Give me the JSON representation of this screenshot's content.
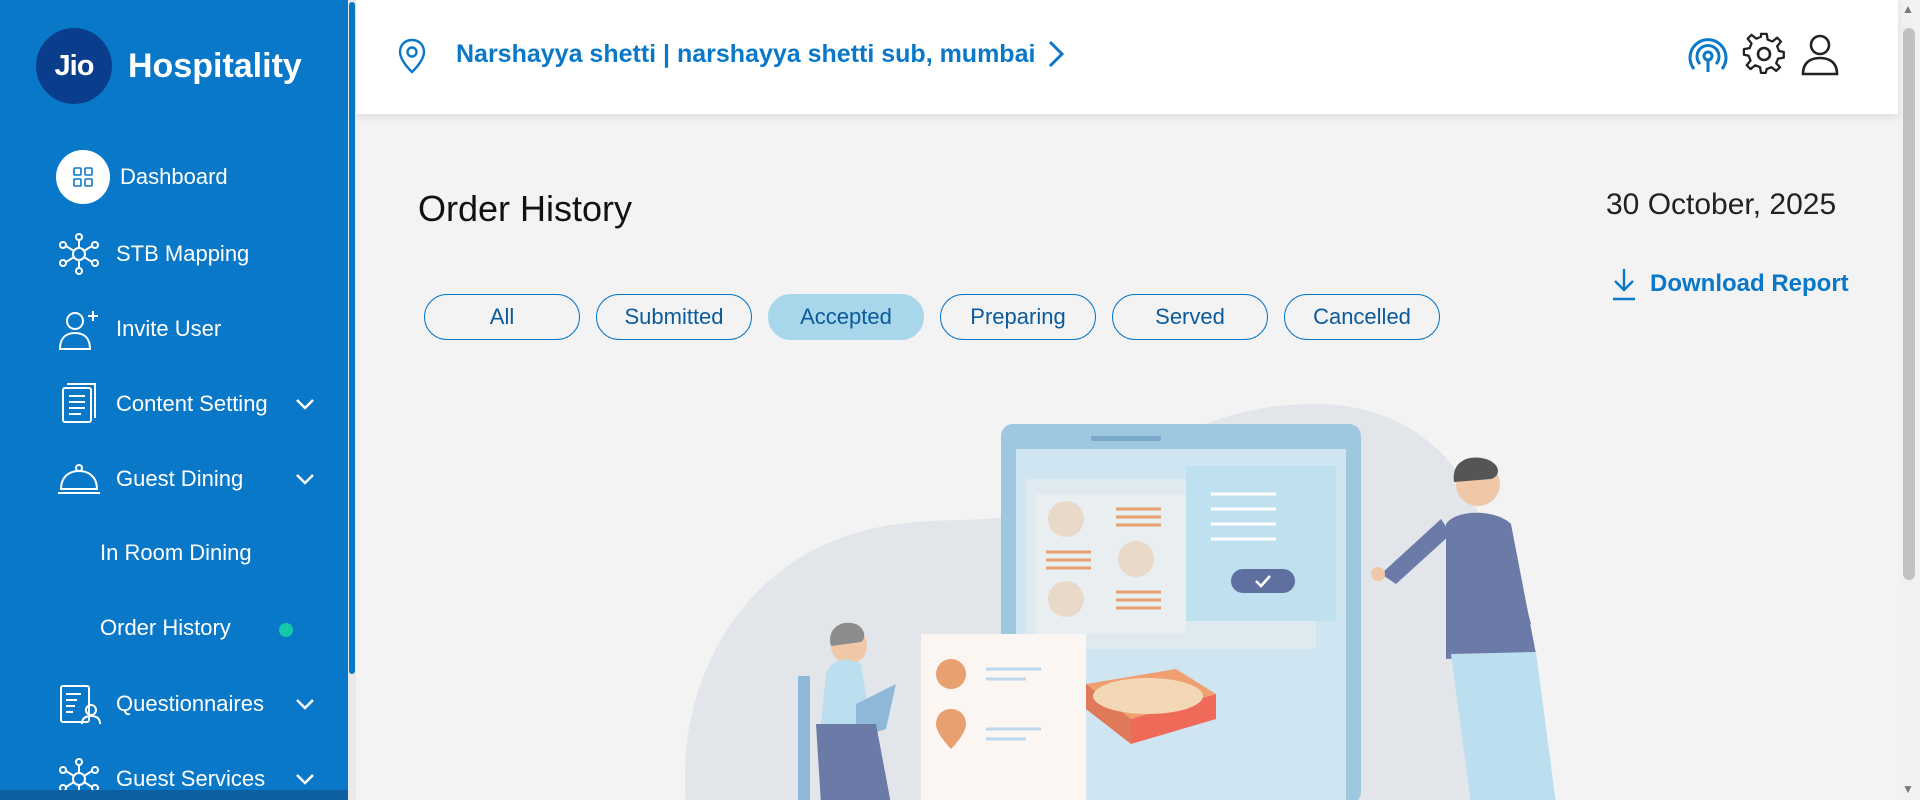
{
  "brand": {
    "logo": "Jio",
    "name": "Hospitality"
  },
  "sidebar": {
    "items": [
      {
        "label": "Dashboard",
        "icon": "dashboard-grid-icon"
      },
      {
        "label": "STB Mapping",
        "icon": "network-icon"
      },
      {
        "label": "Invite User",
        "icon": "add-user-icon"
      },
      {
        "label": "Content Setting",
        "icon": "document-icon"
      },
      {
        "label": "Guest Dining",
        "icon": "cloche-icon"
      },
      {
        "label": "Questionnaires",
        "icon": "questionnaire-icon"
      },
      {
        "label": "Guest Services",
        "icon": "network-icon"
      }
    ],
    "sub_items": [
      {
        "label": "In Room Dining"
      },
      {
        "label": "Order History"
      }
    ]
  },
  "header": {
    "location": "Narshayya shetti | narshayya shetti sub, mumbai",
    "icons": [
      "broadcast-icon",
      "gear-icon",
      "user-icon"
    ]
  },
  "main": {
    "title": "Order History",
    "date": "30 October, 2025",
    "download_label": "Download Report",
    "tabs": [
      {
        "label": "All",
        "active": false
      },
      {
        "label": "Submitted",
        "active": false
      },
      {
        "label": "Accepted",
        "active": true
      },
      {
        "label": "Preparing",
        "active": false
      },
      {
        "label": "Served",
        "active": false
      },
      {
        "label": "Cancelled",
        "active": false
      }
    ]
  },
  "colors": {
    "brand_blue": "#0a78c8",
    "active_tab": "#a8d6ea",
    "status_dot": "#14c9a8"
  }
}
